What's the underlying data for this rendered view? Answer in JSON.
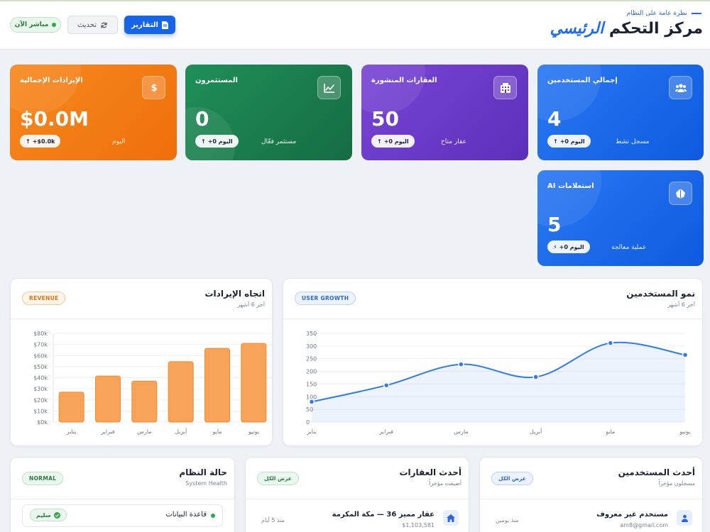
{
  "header": {
    "breadcrumb": "نظرة عامة على النظام",
    "title_main": "مركز التحكم ",
    "title_accent": "الرئيسي",
    "live_label": "مباشر الآن",
    "refresh_label": "تحديث",
    "reports_label": "التقارير"
  },
  "stats": [
    {
      "label": "إجمالي المستخدمين",
      "value": "4",
      "trend": "+0 اليوم",
      "sub": "مسجل نشط",
      "icon": "users-icon",
      "color": "#1765e6"
    },
    {
      "label": "العقارات المنشورة",
      "value": "50",
      "trend": "+0 اليوم",
      "sub": "عقار متاح",
      "icon": "building-icon",
      "color": "#6a3bc8"
    },
    {
      "label": "المستثمرون",
      "value": "0",
      "trend": "+0 اليوم",
      "sub": "مستثمر فعّال",
      "icon": "chart-line-icon",
      "color": "#1b7d4e"
    },
    {
      "label": "الإيرادات الإجمالية",
      "value": "$0.0M",
      "trend": "+$0.0k",
      "sub": "اليوم",
      "icon": "dollar-icon",
      "color": "#f17c12"
    },
    {
      "label": "استعلامات AI",
      "value": "5",
      "trend": "+0 اليوم",
      "sub": "عملية معالجة",
      "icon": "brain-icon",
      "color": "#1765e6"
    }
  ],
  "revenue_panel": {
    "title": "اتجاه الإيرادات",
    "subtitle": "آخر 6 أشهر",
    "badge": "REVENUE"
  },
  "users_panel": {
    "title": "نمو المستخدمين",
    "subtitle": "آخر 6 أشهر",
    "badge": "USER GROWTH"
  },
  "chart_data": [
    {
      "type": "bar",
      "title": "اتجاه الإيرادات",
      "categories": [
        "يناير",
        "فبراير",
        "مارس",
        "أبريل",
        "مايو",
        "يونيو"
      ],
      "values": [
        27000,
        41500,
        37000,
        54500,
        66500,
        71000
      ],
      "ylim": [
        0,
        80000
      ],
      "yticks": [
        "$0k",
        "$10k",
        "$20k",
        "$30k",
        "$40k",
        "$50k",
        "$60k",
        "$70k",
        "$80k"
      ],
      "grid": true,
      "color": "#f7a35a"
    },
    {
      "type": "area",
      "title": "نمو المستخدمين",
      "categories": [
        "يناير",
        "فبراير",
        "مارس",
        "أبريل",
        "مايو",
        "يونيو"
      ],
      "values": [
        80,
        145,
        228,
        178,
        312,
        265
      ],
      "ylim": [
        0,
        350
      ],
      "yticks": [
        "0",
        "50",
        "100",
        "150",
        "200",
        "250",
        "300",
        "350"
      ],
      "grid": true,
      "color": "#2f7be8"
    }
  ],
  "bottom": {
    "users": {
      "title": "أحدث المستخدمين",
      "subtitle": "مسجلون مؤخراً",
      "action": "عرض الكل",
      "item_name": "مستخدم غير معروف",
      "item_email": "am8@gmail.com",
      "item_time": "منذ يومين"
    },
    "properties": {
      "title": "أحدث العقارات",
      "subtitle": "أضيفت مؤخراً",
      "action": "عرض الكل",
      "item_name": "عقار مميز 36 — مكة المكرمة",
      "item_price": "$1,103,581",
      "item_time": "منذ 5 أيام"
    },
    "health": {
      "title": "حالة النظام",
      "subtitle": "System Health",
      "badge": "NORMAL",
      "item_label": "قاعدة البيانات",
      "item_status": "سليم"
    }
  }
}
